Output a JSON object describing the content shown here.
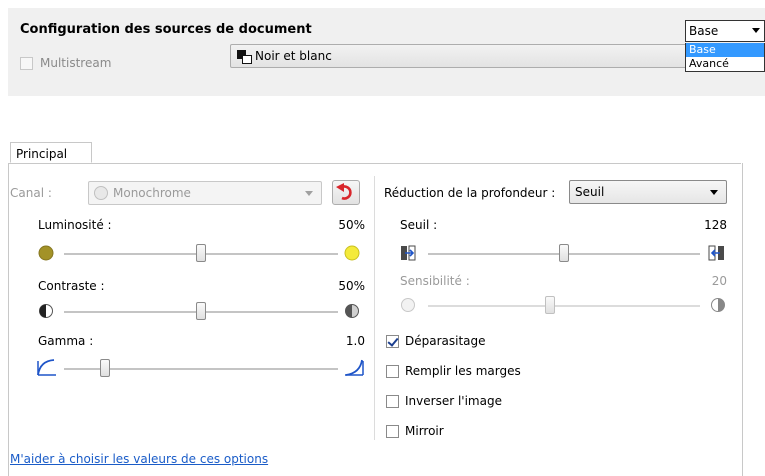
{
  "top": {
    "title": "Configuration des sources de document",
    "multistream_label": "Multistream",
    "color_mode": {
      "icon": "black-white-icon",
      "label": "Noir et blanc"
    },
    "mode_select": {
      "value": "Base",
      "options": [
        "Base",
        "Avancé"
      ],
      "highlight": "#3399ff"
    }
  },
  "tabs": [
    {
      "label": "Principal",
      "selected": true
    }
  ],
  "left": {
    "channel_label": "Canal :",
    "channel_value": "Monochrome",
    "brightness": {
      "label": "Luminosité :",
      "value": "50%",
      "level": 0.5
    },
    "contrast": {
      "label": "Contraste :",
      "value": "50%",
      "level": 0.5
    },
    "gamma": {
      "label": "Gamma :",
      "value": "1.0",
      "level": 0.15
    }
  },
  "right": {
    "depth_label": "Réduction de la profondeur :",
    "depth_value": "Seuil",
    "threshold": {
      "label": "Seuil :",
      "value": "128",
      "level": 0.5
    },
    "sensitivity": {
      "label": "Sensibilité :",
      "value": "20",
      "level": 0.45
    },
    "checkboxes": [
      {
        "label": "Déparasitage",
        "checked": true
      },
      {
        "label": "Remplir les marges",
        "checked": false
      },
      {
        "label": "Inverser l'image",
        "checked": false
      },
      {
        "label": "Mirroir",
        "checked": false
      }
    ]
  },
  "help_link": "M'aider à choisir les valeurs de ces options"
}
